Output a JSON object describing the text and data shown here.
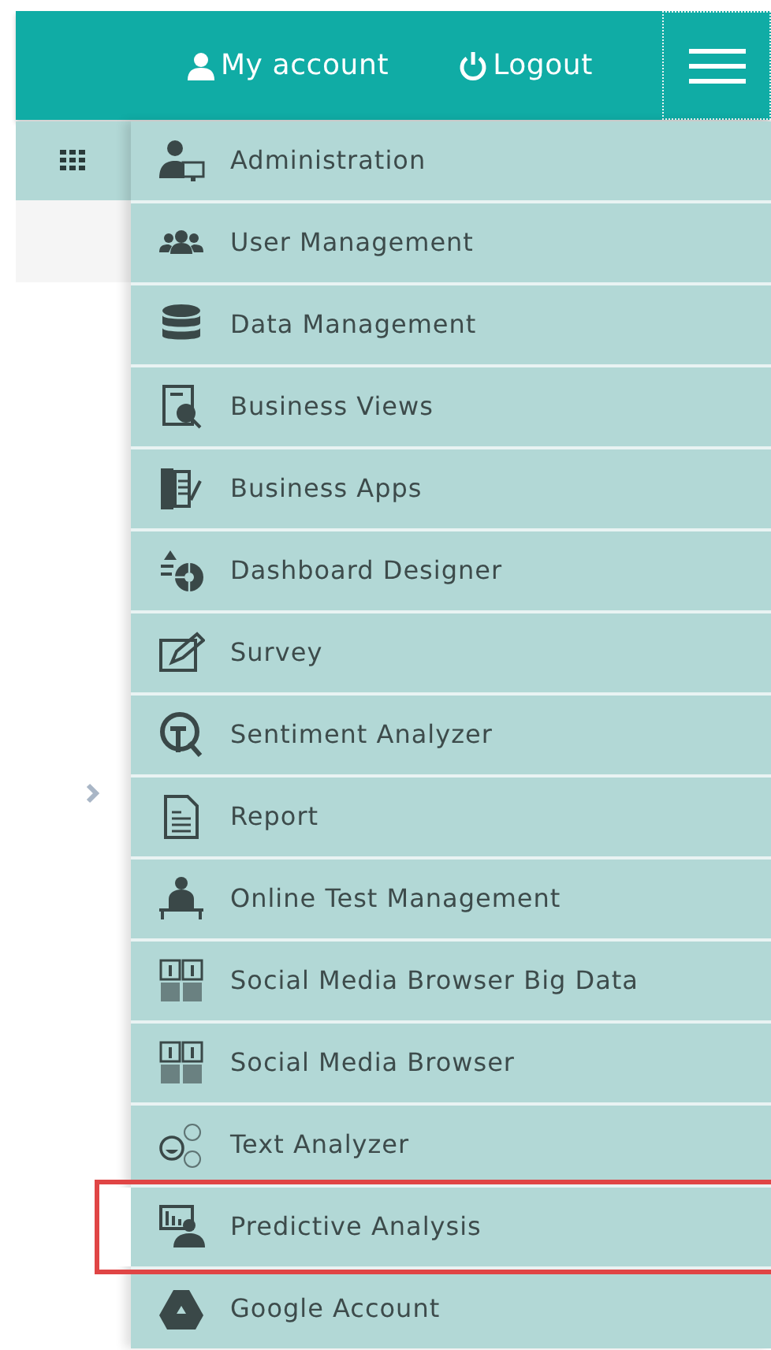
{
  "header": {
    "account_link": "My account",
    "logout_link": "Logout"
  },
  "menu": {
    "items": [
      {
        "label": "Administration",
        "highlighted": false
      },
      {
        "label": "User Management",
        "highlighted": false
      },
      {
        "label": "Data Management",
        "highlighted": false
      },
      {
        "label": "Business Views",
        "highlighted": false
      },
      {
        "label": "Business Apps",
        "highlighted": false
      },
      {
        "label": "Dashboard Designer",
        "highlighted": false
      },
      {
        "label": "Survey",
        "highlighted": false
      },
      {
        "label": "Sentiment Analyzer",
        "highlighted": false
      },
      {
        "label": "Report",
        "highlighted": false
      },
      {
        "label": "Online Test Management",
        "highlighted": false
      },
      {
        "label": "Social Media Browser Big Data",
        "highlighted": false
      },
      {
        "label": "Social Media Browser",
        "highlighted": false
      },
      {
        "label": "Text Analyzer",
        "highlighted": false
      },
      {
        "label": "Predictive Analysis",
        "highlighted": true
      },
      {
        "label": "Google Account",
        "highlighted": false
      }
    ]
  }
}
